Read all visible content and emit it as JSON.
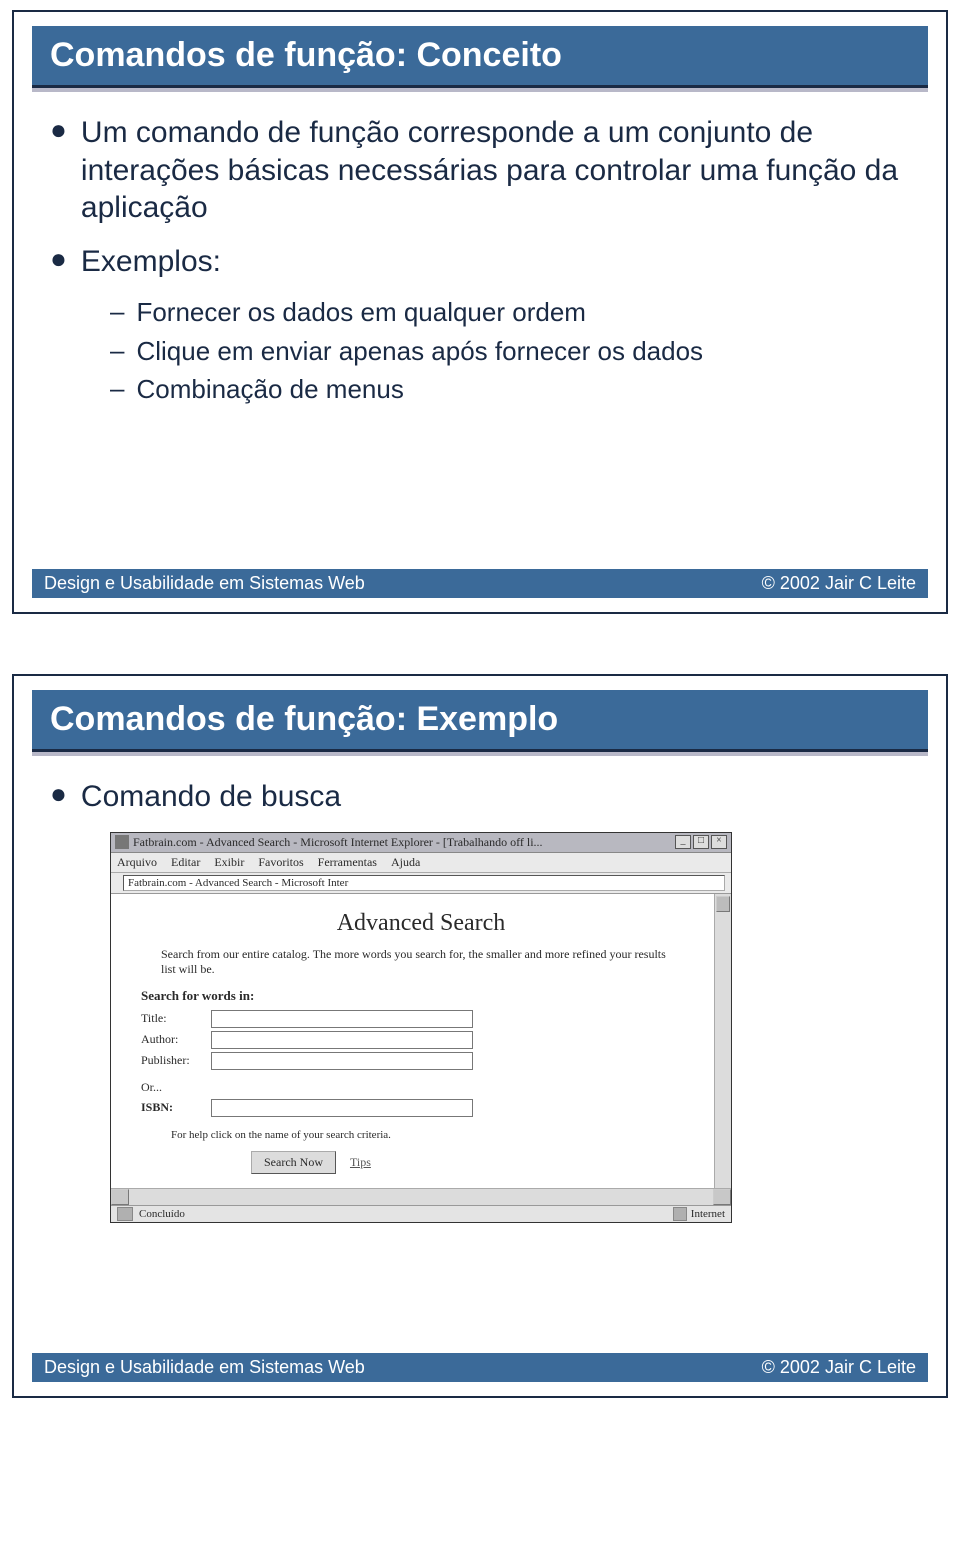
{
  "slide1": {
    "title": "Comandos de função: Conceito",
    "bullets": [
      {
        "text": "Um comando de função corresponde a um conjunto de interações básicas necessárias para controlar uma função da aplicação",
        "sub": []
      },
      {
        "text": "Exemplos:",
        "sub": [
          "Fornecer os dados em qualquer ordem",
          "Clique em enviar apenas após fornecer os dados",
          "Combinação de menus"
        ]
      }
    ],
    "footer_left": "Design e Usabilidade em  Sistemas Web",
    "footer_right": "© 2002 Jair C Leite"
  },
  "slide2": {
    "title": "Comandos de função: Exemplo",
    "bullet": "Comando de busca",
    "footer_left": "Design e Usabilidade em  Sistemas Web",
    "footer_right": "© 2002 Jair C Leite",
    "browser": {
      "window_title": "Fatbrain.com - Advanced Search - Microsoft Internet Explorer - [Trabalhando off li...",
      "menus": [
        "Arquivo",
        "Editar",
        "Exibir",
        "Favoritos",
        "Ferramentas",
        "Ajuda"
      ],
      "address_label": "",
      "address_value": "Fatbrain.com - Advanced Search - Microsoft Inter",
      "page_heading": "Advanced Search",
      "page_desc": "Search from our entire catalog. The more words you search for, the smaller and more refined your results list will be.",
      "section_label": "Search for words in:",
      "fields": [
        {
          "label": "Title:"
        },
        {
          "label": "Author:"
        },
        {
          "label": "Publisher:"
        }
      ],
      "or_label": "Or...",
      "isbn_label": "ISBN:",
      "help_text": "For help click on the name of your search criteria.",
      "search_button": "Search Now",
      "tips_link": "Tips",
      "status_left": "Concluído",
      "status_right": "Internet"
    }
  }
}
